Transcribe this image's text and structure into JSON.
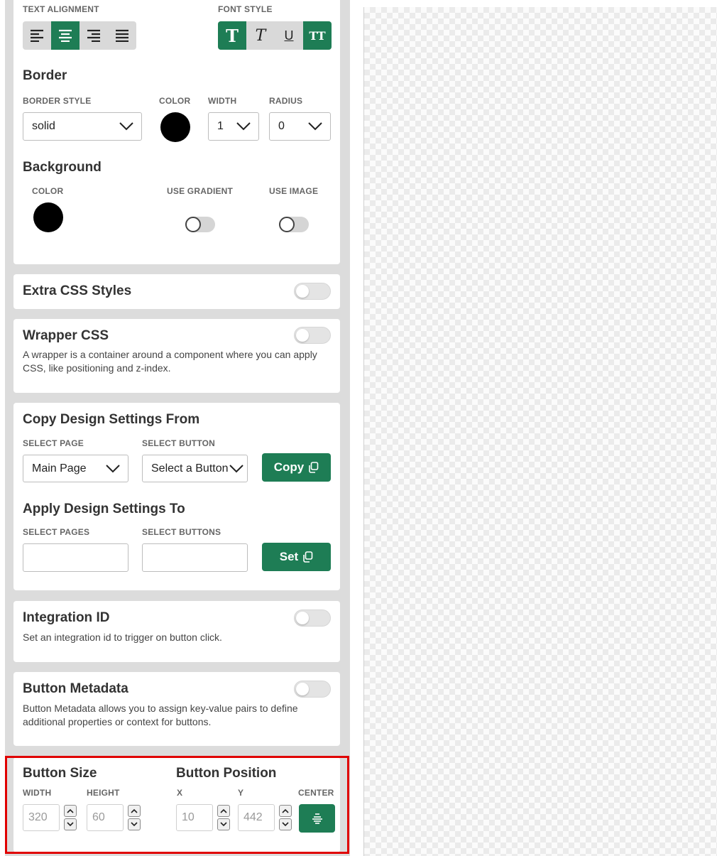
{
  "text_alignment": {
    "label": "TEXT ALIGNMENT",
    "options": [
      "align-left",
      "align-center",
      "align-right",
      "align-justify"
    ],
    "active": 1
  },
  "font_style": {
    "label": "FONT STYLE",
    "options": [
      {
        "glyph": "T",
        "active": true
      },
      {
        "glyph": "T",
        "active": false
      },
      {
        "glyph": "U",
        "active": false
      },
      {
        "glyph": "TT",
        "active": true
      }
    ]
  },
  "border": {
    "title": "Border",
    "style_label": "BORDER STYLE",
    "style_value": "solid",
    "color_label": "COLOR",
    "color": "#000000",
    "width_label": "WIDTH",
    "width_value": "1",
    "radius_label": "RADIUS",
    "radius_value": "0"
  },
  "background": {
    "title": "Background",
    "color_label": "COLOR",
    "color": "#000000",
    "gradient_label": "USE GRADIENT",
    "image_label": "USE IMAGE"
  },
  "extra_css": {
    "title": "Extra CSS Styles"
  },
  "wrapper_css": {
    "title": "Wrapper CSS",
    "description": "A wrapper is a container around a component where you can apply CSS, like positioning and z-index."
  },
  "copy_design": {
    "title": "Copy Design Settings From",
    "page_label": "SELECT PAGE",
    "page_value": "Main Page",
    "button_label": "SELECT BUTTON",
    "button_value": "Select a Button",
    "copy_label": "Copy"
  },
  "apply_design": {
    "title": "Apply Design Settings To",
    "pages_label": "SELECT PAGES",
    "buttons_label": "SELECT BUTTONS",
    "set_label": "Set"
  },
  "integration": {
    "title": "Integration ID",
    "description": "Set an integration id to trigger on button click."
  },
  "metadata": {
    "title": "Button Metadata",
    "description": "Button Metadata allows you to assign key-value pairs to define additional properties or context for buttons."
  },
  "button_size": {
    "title": "Button Size",
    "width_label": "WIDTH",
    "width_value": "320",
    "height_label": "HEIGHT",
    "height_value": "60"
  },
  "button_position": {
    "title": "Button Position",
    "x_label": "X",
    "x_value": "10",
    "y_label": "Y",
    "y_value": "442",
    "center_label": "CENTER"
  },
  "colors": {
    "accent": "#1e7d55",
    "highlight": "#e00000"
  }
}
